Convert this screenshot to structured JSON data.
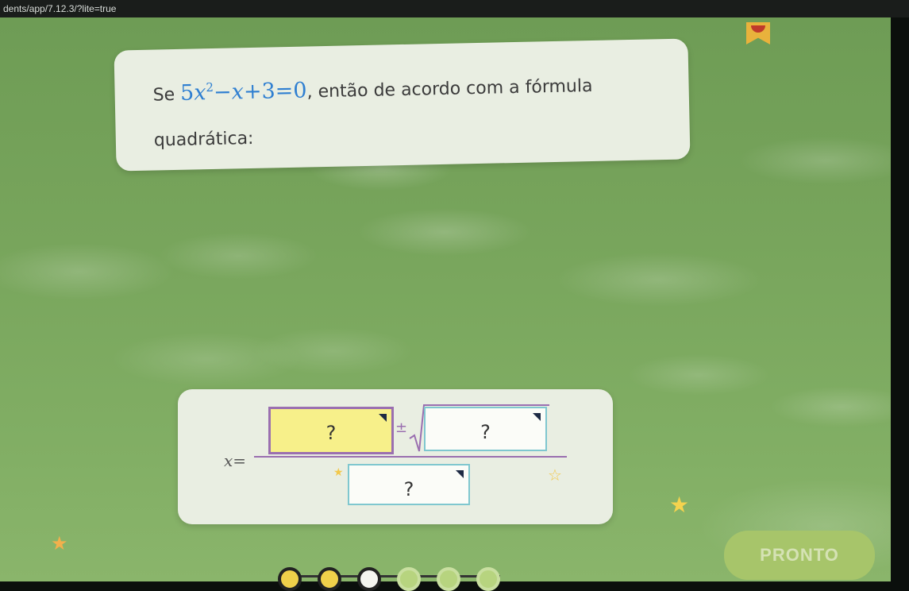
{
  "browser": {
    "url": "dents/app/7.12.3/?lite=true"
  },
  "question": {
    "prefix": "Se",
    "eq_coef": "5",
    "eq_var": "x",
    "eq_exp": "2",
    "eq_rest_minus": "−",
    "eq_var2": "x",
    "eq_rest": "+3=0",
    "suffix": ", então de acordo com a fórmula",
    "line2": "quadrática:"
  },
  "formula": {
    "x_var": "x",
    "equals": "=",
    "plus_minus": "±",
    "box_numerator_left": "?",
    "box_radicand": "?",
    "box_denominator": "?"
  },
  "buttons": {
    "pronto": "PRONTO"
  },
  "progress": {
    "total": 6,
    "done": 2,
    "current": 3
  },
  "colors": {
    "background": "#78a55c",
    "card": "#e9eee2",
    "equation": "#2f7fd1",
    "selected_box": "#f7f08a",
    "box_border": "#7fc7cf",
    "button": "#a7c56a"
  }
}
